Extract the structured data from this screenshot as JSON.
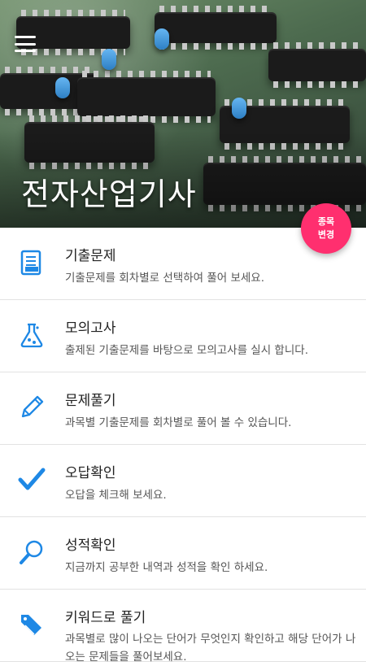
{
  "header": {
    "title": "전자산업기사",
    "change_subject": "종목\n변경"
  },
  "menu": {
    "items": [
      {
        "icon": "exam-doc-icon",
        "label": "기출문제",
        "desc": "기출문제를 회차별로 선택하여 풀어 보세요."
      },
      {
        "icon": "flask-icon",
        "label": "모의고사",
        "desc": "출제된 기출문제를 바탕으로 모의고사를 실시 합니다."
      },
      {
        "icon": "pencil-icon",
        "label": "문제풀기",
        "desc": "과목별 기출문제를 회차별로 풀어 볼 수 있습니다."
      },
      {
        "icon": "check-icon",
        "label": "오답확인",
        "desc": "오답을 체크해 보세요."
      },
      {
        "icon": "search-icon",
        "label": "성적확인",
        "desc": "지금까지 공부한 내역과 성적을 확인 하세요."
      },
      {
        "icon": "tag-icon",
        "label": "키워드로 풀기",
        "desc": "과목별로 많이 나오는 단어가 무엇인지 확인하고 해당 단어가 나오는 문제들을 풀어보세요."
      }
    ]
  },
  "colors": {
    "accent": "#1e88e5",
    "fab": "#ff2f6f"
  }
}
